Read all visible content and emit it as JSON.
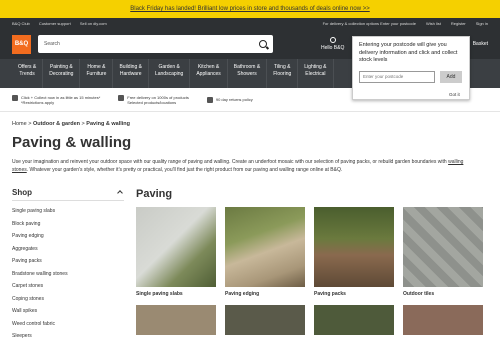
{
  "promo": {
    "text": "Black Friday has landed! Brilliant low prices in store and thousands of deals online now >>"
  },
  "util": {
    "links": [
      "B&Q Club",
      "Customer support",
      "Sell on diy.com"
    ],
    "right": [
      "For delivery & collection options  Enter your postcode",
      "Wish list",
      "Register",
      "Sign in"
    ]
  },
  "header": {
    "logo": "B&Q",
    "search_placeholder": "Search",
    "hello": "Hello B&Q",
    "basket": "Basket"
  },
  "nav": [
    [
      "Offers &",
      "Trends"
    ],
    [
      "Painting &",
      "Decorating"
    ],
    [
      "Home &",
      "Furniture"
    ],
    [
      "Building &",
      "Hardware"
    ],
    [
      "Garden &",
      "Landscaping"
    ],
    [
      "Kitchen &",
      "Appliances"
    ],
    [
      "Bathroom &",
      "Showers"
    ],
    [
      "Tiling &",
      "Flooring"
    ],
    [
      "Lighting &",
      "Electrical"
    ]
  ],
  "info": [
    [
      "Click + Collect now in as little as 15 minutes*",
      "*Restrictions apply"
    ],
    [
      "Free delivery on 1000s of products",
      "Selected products/locations"
    ],
    [
      "90 day returns policy",
      ""
    ]
  ],
  "breadcrumb": {
    "home": "Home",
    "outdoor": "Outdoor & garden",
    "current": "Paving & walling"
  },
  "title": "Paving & walling",
  "intro": {
    "pre": "Use your imagination and reinvent your outdoor space with our quality range of paving and walling. Create an underfoot mosaic with our selection of paving packs, or rebuild garden boundaries with ",
    "link": "walling stones",
    "post": ". Whatever your garden's style, whether it's pretty or practical, you'll find just the right product from our paving and walling range online at B&Q."
  },
  "sidebar": {
    "heading": "Shop",
    "items": [
      "Single paving slabs",
      "Block paving",
      "Paving edging",
      "Aggregates",
      "Paving packs",
      "Bradstone walling stones",
      "Carpet stones",
      "Coping stones",
      "Wall spikes",
      "Weed control fabric",
      "Sleepers"
    ]
  },
  "section": "Paving",
  "cards": [
    "Single paving slabs",
    "Paving edging",
    "Paving packs",
    "Outdoor tiles"
  ],
  "popup": {
    "message": "Entering your postcode will give you delivery information and click and collect stock levels",
    "placeholder": "Enter your postcode",
    "add": "Add",
    "gotit": "Got it"
  },
  "colors": {
    "accent": "#f26c1f",
    "promo": "#f5d000",
    "dark": "#2d3033"
  }
}
